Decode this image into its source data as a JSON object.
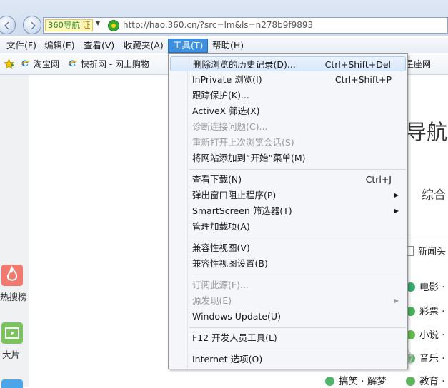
{
  "address": {
    "site_badge": "360导航",
    "cert_badge": "证",
    "url": "http://hao.360.cn/?src=lm&ls=n278b9f9893"
  },
  "menubar": {
    "items": [
      {
        "label": "文件(F)"
      },
      {
        "label": "编辑(E)"
      },
      {
        "label": "查看(V)"
      },
      {
        "label": "收藏夹(A)"
      },
      {
        "label": "工具(T)"
      },
      {
        "label": "帮助(H)"
      }
    ]
  },
  "favorites": {
    "items": [
      {
        "label": "淘宝网"
      },
      {
        "label": "快折网 - 网上购物"
      },
      {
        "label": "星座网"
      }
    ]
  },
  "tools_menu": {
    "groups": [
      [
        {
          "label": "删除浏览的历史记录(D)...",
          "shortcut": "Ctrl+Shift+Del",
          "highlighted": true
        },
        {
          "label": "InPrivate 浏览(I)",
          "shortcut": "Ctrl+Shift+P"
        },
        {
          "label": "跟踪保护(K)..."
        },
        {
          "label": "ActiveX 筛选(X)"
        },
        {
          "label": "诊断连接问题(C)...",
          "disabled": true
        },
        {
          "label": "重新打开上次浏览会话(S)",
          "disabled": true
        },
        {
          "label": "将网站添加到“开始”菜单(M)"
        }
      ],
      [
        {
          "label": "查看下载(N)",
          "shortcut": "Ctrl+J"
        },
        {
          "label": "弹出窗口阻止程序(P)",
          "submenu": true
        },
        {
          "label": "SmartScreen 筛选器(T)",
          "submenu": true
        },
        {
          "label": "管理加载项(A)"
        }
      ],
      [
        {
          "label": "兼容性视图(V)"
        },
        {
          "label": "兼容性视图设置(B)"
        }
      ],
      [
        {
          "label": "订阅此源(F)...",
          "disabled": true
        },
        {
          "label": "源发现(E)",
          "disabled": true,
          "submenu": true
        },
        {
          "label": "Windows Update(U)"
        }
      ],
      [
        {
          "label": "F12 开发人员工具(L)"
        }
      ],
      [
        {
          "label": "Internet 选项(O)"
        }
      ]
    ]
  },
  "page": {
    "left_tiles": [
      {
        "label": "热搜榜"
      },
      {
        "label": "大片"
      }
    ],
    "heading_partial": "导航",
    "category_partial": "综合",
    "news_partial": "新闻头",
    "links": [
      {
        "label": "电影 ·"
      },
      {
        "label": "彩票 ·"
      },
      {
        "label": "小说 ·"
      },
      {
        "label": "音乐 ·"
      },
      {
        "label": "搞笑 · 解梦"
      },
      {
        "label": "教育 ·"
      }
    ]
  },
  "colors": {
    "menu_active": "#3d8fe0",
    "menu_highlight": "#d9e8fb",
    "disabled_text": "#9a9a9a"
  }
}
